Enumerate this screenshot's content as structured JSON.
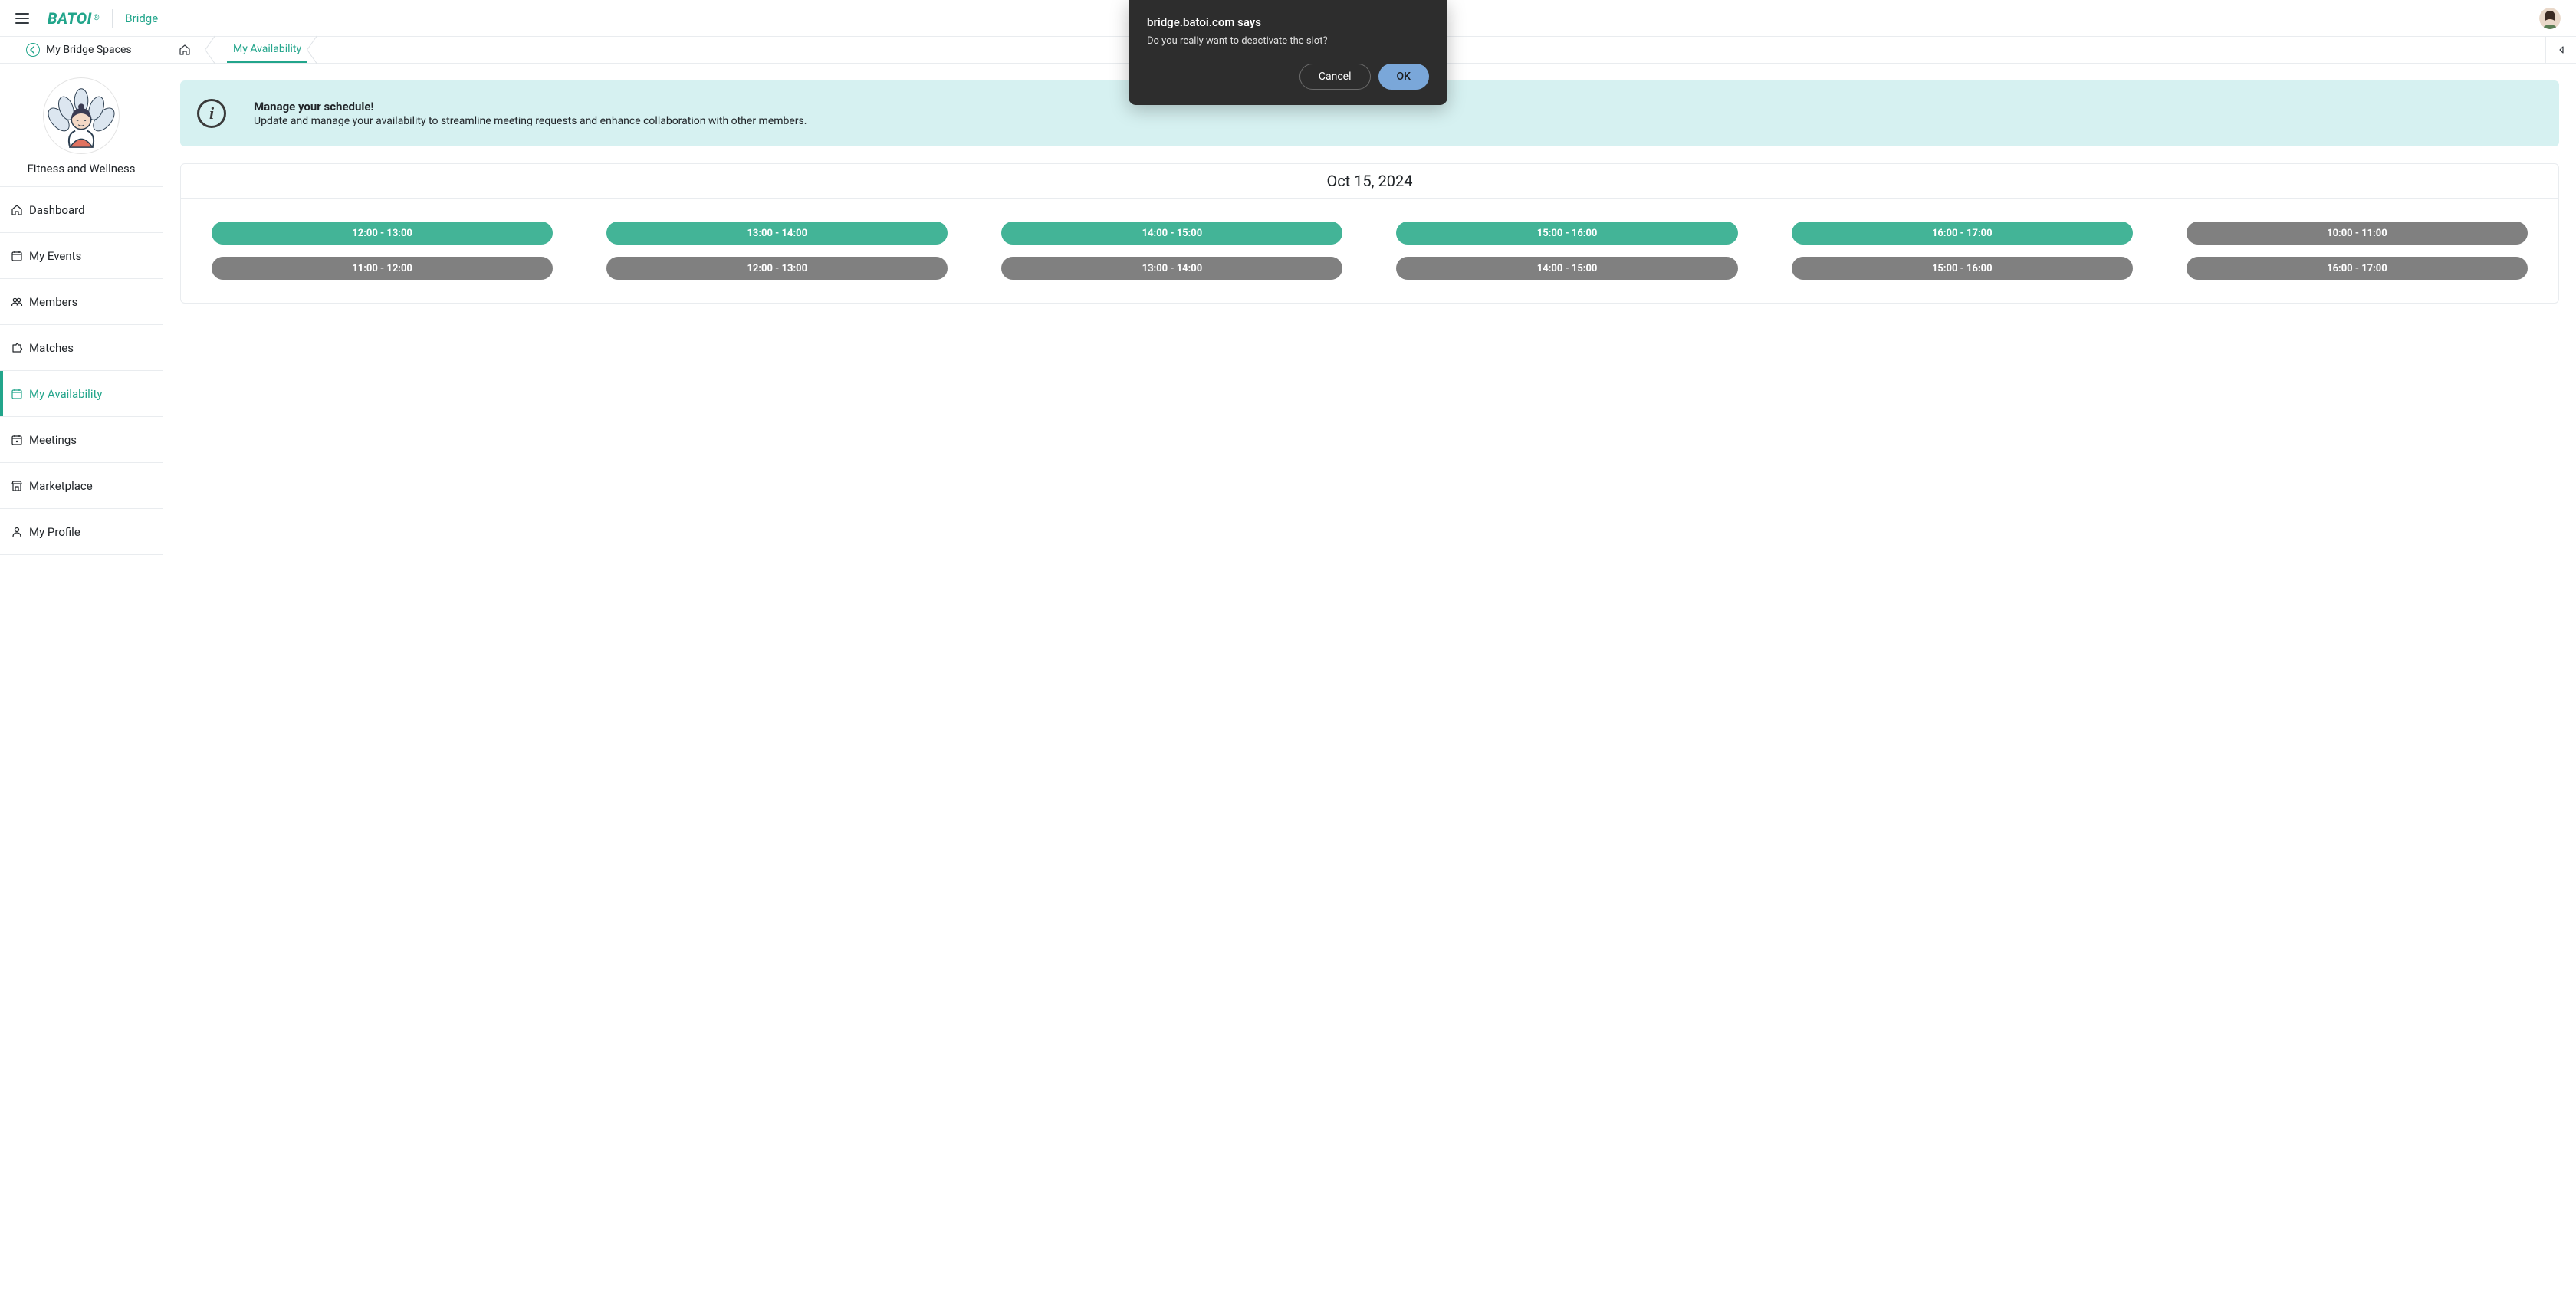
{
  "header": {
    "logo_text": "BATOI",
    "app_label": "Bridge"
  },
  "secondbar": {
    "back_label": "My Bridge Spaces",
    "breadcrumb_current": "My Availability"
  },
  "sidebar": {
    "space_title": "Fitness and Wellness",
    "items": [
      {
        "id": "dashboard",
        "label": "Dashboard"
      },
      {
        "id": "my-events",
        "label": "My Events"
      },
      {
        "id": "members",
        "label": "Members"
      },
      {
        "id": "matches",
        "label": "Matches"
      },
      {
        "id": "my-availability",
        "label": "My Availability"
      },
      {
        "id": "meetings",
        "label": "Meetings"
      },
      {
        "id": "marketplace",
        "label": "Marketplace"
      },
      {
        "id": "my-profile",
        "label": "My Profile"
      }
    ]
  },
  "banner": {
    "title": "Manage your schedule!",
    "desc": "Update and manage your availability to streamline meeting requests and enhance collaboration with other members."
  },
  "availability": {
    "date_label": "Oct 15, 2024",
    "slots": [
      {
        "label": "12:00 - 13:00",
        "state": "active"
      },
      {
        "label": "13:00 - 14:00",
        "state": "active"
      },
      {
        "label": "14:00 - 15:00",
        "state": "active"
      },
      {
        "label": "15:00 - 16:00",
        "state": "active"
      },
      {
        "label": "16:00 - 17:00",
        "state": "active"
      },
      {
        "label": "10:00 - 11:00",
        "state": "inactive"
      },
      {
        "label": "11:00 - 12:00",
        "state": "inactive"
      },
      {
        "label": "12:00 - 13:00",
        "state": "inactive"
      },
      {
        "label": "13:00 - 14:00",
        "state": "inactive"
      },
      {
        "label": "14:00 - 15:00",
        "state": "inactive"
      },
      {
        "label": "15:00 - 16:00",
        "state": "inactive"
      },
      {
        "label": "16:00 - 17:00",
        "state": "inactive"
      }
    ]
  },
  "dialog": {
    "title": "bridge.batoi.com says",
    "message": "Do you really want to deactivate the slot?",
    "cancel_label": "Cancel",
    "ok_label": "OK"
  },
  "colors": {
    "accent": "#22a58b",
    "slot_active": "#43b497",
    "slot_inactive": "#808080",
    "banner_bg": "#d6f1f1",
    "dialog_bg": "#2d2d2d",
    "dialog_ok": "#7aa7d9"
  }
}
